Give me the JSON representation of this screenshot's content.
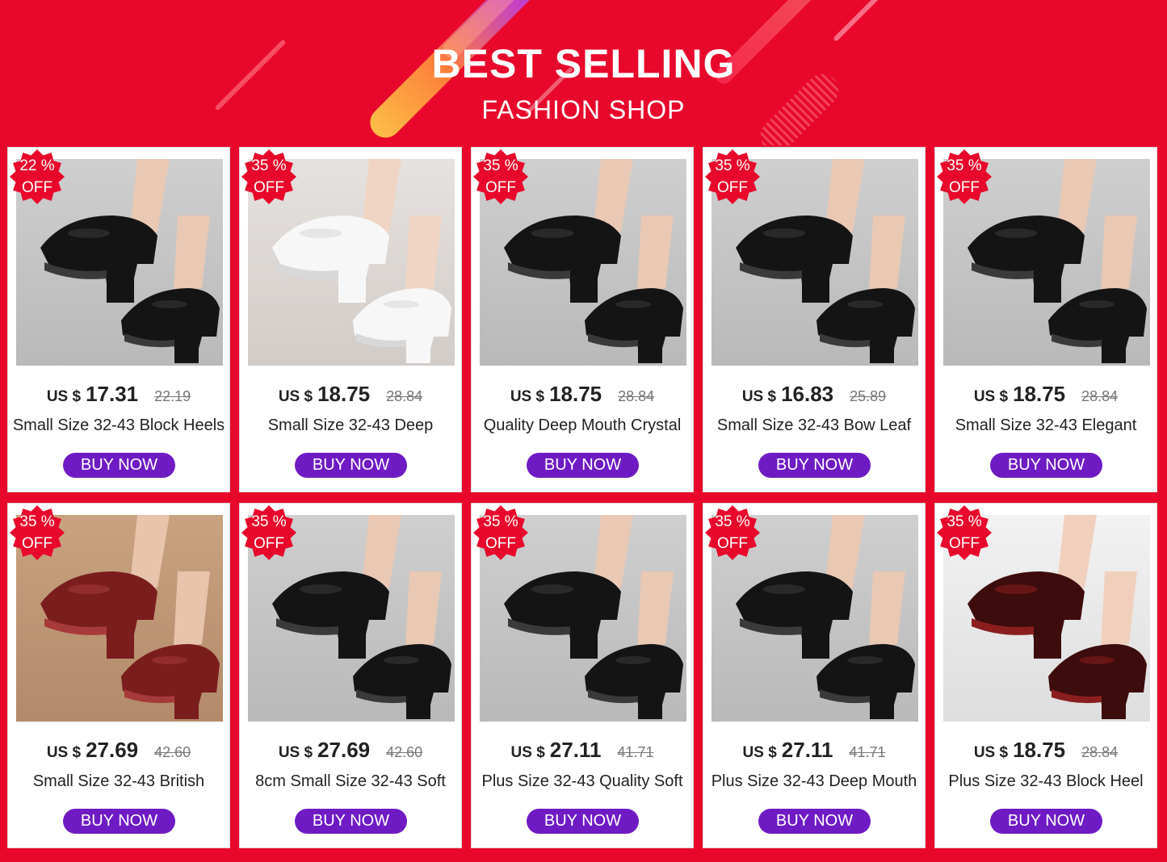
{
  "banner": {
    "title": "BEST SELLING",
    "subtitle": "FASHION SHOP"
  },
  "colors": {
    "background": "#e8082b",
    "button": "#6f1bc4",
    "badge": "#e8082b"
  },
  "products": [
    {
      "discount": "22 %",
      "off": "OFF",
      "currency": "US $",
      "price": "17.31",
      "old_price": "22.19",
      "name": "Small Size 32-43 Block Heels",
      "button": "BUY NOW",
      "shoe_color": "black",
      "icon": "black-heel-bootie-image"
    },
    {
      "discount": "35 %",
      "off": "OFF",
      "currency": "US $",
      "price": "18.75",
      "old_price": "28.84",
      "name": "Small Size 32-43 Deep",
      "button": "BUY NOW",
      "shoe_color": "white",
      "icon": "white-platform-bootie-image"
    },
    {
      "discount": "35 %",
      "off": "OFF",
      "currency": "US $",
      "price": "18.75",
      "old_price": "28.84",
      "name": "Quality Deep Mouth Crystal",
      "button": "BUY NOW",
      "shoe_color": "black",
      "icon": "black-crystal-bootie-image"
    },
    {
      "discount": "35 %",
      "off": "OFF",
      "currency": "US $",
      "price": "16.83",
      "old_price": "25.89",
      "name": "Small Size 32-43 Bow Leaf",
      "button": "BUY NOW",
      "shoe_color": "black",
      "icon": "black-bow-bootie-image"
    },
    {
      "discount": "35 %",
      "off": "OFF",
      "currency": "US $",
      "price": "18.75",
      "old_price": "28.84",
      "name": "Small Size 32-43 Elegant",
      "button": "BUY NOW",
      "shoe_color": "black",
      "icon": "black-elegant-bootie-image"
    },
    {
      "discount": "35 %",
      "off": "OFF",
      "currency": "US $",
      "price": "27.69",
      "old_price": "42.60",
      "name": "Small Size 32-43 British",
      "button": "BUY NOW",
      "shoe_color": "burgundy",
      "icon": "burgundy-lace-up-shoe-image"
    },
    {
      "discount": "35 %",
      "off": "OFF",
      "currency": "US $",
      "price": "27.69",
      "old_price": "42.60",
      "name": "8cm Small Size 32-43 Soft",
      "button": "BUY NOW",
      "shoe_color": "black",
      "icon": "black-platform-shoe-image"
    },
    {
      "discount": "35 %",
      "off": "OFF",
      "currency": "US $",
      "price": "27.11",
      "old_price": "41.71",
      "name": "Plus Size 32-43 Quality Soft",
      "button": "BUY NOW",
      "shoe_color": "black",
      "icon": "black-buckle-shoe-image"
    },
    {
      "discount": "35 %",
      "off": "OFF",
      "currency": "US $",
      "price": "27.11",
      "old_price": "41.71",
      "name": "Plus Size 32-43 Deep Mouth",
      "button": "BUY NOW",
      "shoe_color": "black",
      "icon": "black-lace-up-platform-image"
    },
    {
      "discount": "35 %",
      "off": "OFF",
      "currency": "US $",
      "price": "18.75",
      "old_price": "28.84",
      "name": "Plus Size 32-43 Block Heel",
      "button": "BUY NOW",
      "shoe_color": "patent-burgundy",
      "icon": "patent-block-heel-image"
    }
  ]
}
